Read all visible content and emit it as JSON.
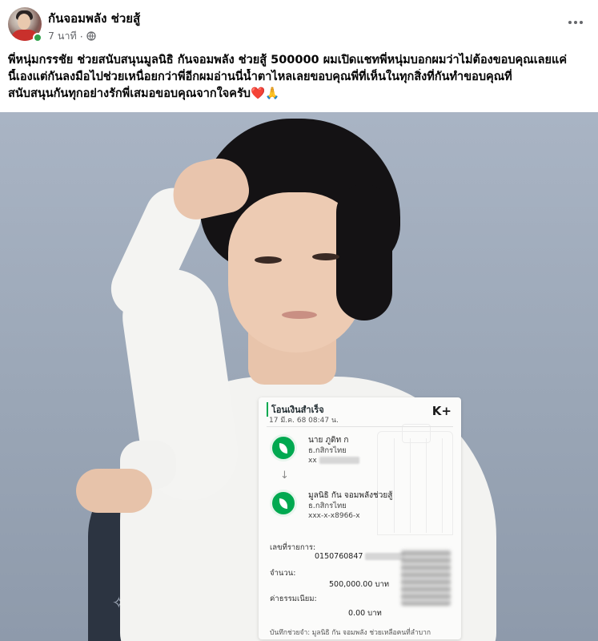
{
  "post": {
    "page_name": "กันจอมพลัง ช่วยสู้",
    "time": "7 นาที",
    "separator": "·",
    "text_lines": [
      "พี่หนุ่มกรรชัย ช่วยสนับสนุนมูลนิธิ กันจอมพลัง ช่วยสู้ 500000 ผมเปิดแชทพี่หนุ่มบอกผมว่าไม่ต้องขอบคุณเลยแค่",
      "นี้เองแต่กันลงมือไปช่วยเหนื่อยกว่าพี่อีกผมอ่านนี่น้ำตาไหลเลยขอบคุณพี่ที่เห็นในทุกสิ่งที่กันทำขอบคุณที่",
      "สนับสนุนกันทุกอย่างรักพี่เสมอขอบคุณจากใจครับ❤️🙏"
    ]
  },
  "icons": {
    "avatar": "avatar",
    "online": "online-status-icon",
    "privacy": "globe-icon",
    "more": "more-options-icon",
    "bank": "kbank-icon",
    "arrow": "arrow-down-icon"
  },
  "receipt": {
    "title": "โอนเงินสำเร็จ",
    "date": "17 มี.ค. 68 08:47 น.",
    "logo": "K+",
    "sender_name": "นาย ภูดิท ก",
    "sender_bank": "ธ.กสิกรไทย",
    "sender_account": "xx",
    "arrow": "↓",
    "receiver_name": "มูลนิธิ กัน จอมพลังช่วยสู้",
    "receiver_bank": "ธ.กสิกรไทย",
    "receiver_account": "xxx-x-x8966-x",
    "ref_label": "เลขที่รายการ:",
    "ref_value": "0150760847",
    "amount_label": "จำนวน:",
    "amount_value": "500,000.00 บาท",
    "fee_label": "ค่าธรรมเนียม:",
    "fee_value": "0.00 บาท",
    "memo": "บันทึกช่วยจำ: มูลนิธิ กัน จอมพลัง ช่วยเหลือคนที่ลำบาก"
  },
  "colors": {
    "kbank_green": "#00a950",
    "online_green": "#31a24c",
    "meta_gray": "#65676b"
  }
}
